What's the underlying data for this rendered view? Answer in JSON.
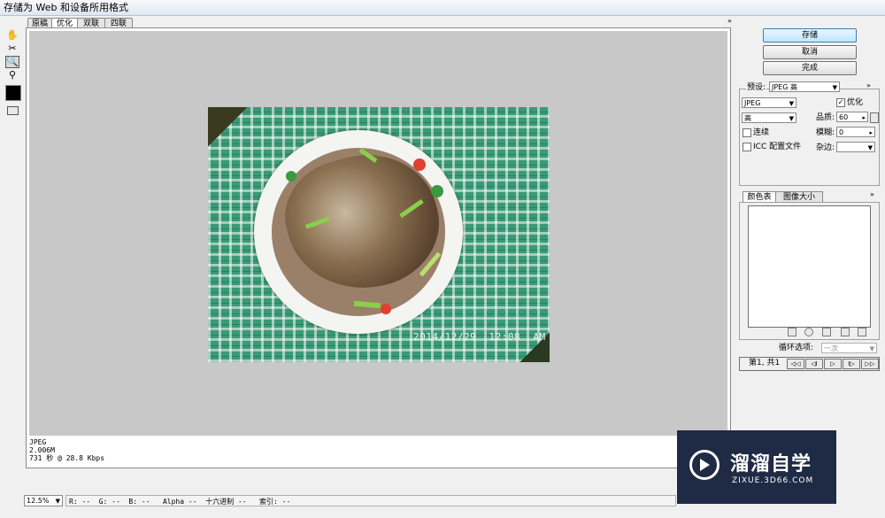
{
  "window": {
    "title": "存储为 Web 和设备所用格式"
  },
  "tabs": [
    {
      "label": "原稿"
    },
    {
      "label": "优化"
    },
    {
      "label": "双联"
    },
    {
      "label": "四联"
    }
  ],
  "tools": {
    "hand": "hand-icon",
    "slice_select": "slice-select-icon",
    "zoom": "zoom-icon",
    "eyedropper": "eyedropper-icon",
    "color_swatch": "#000000",
    "toggle_slices": "toggle-slices-icon"
  },
  "preview": {
    "photo_timestamp": "2014/12/29  12:08  AM",
    "info_format": "JPEG",
    "info_size": "2.006M",
    "info_time": "731 秒 @ 28.8 Kbps"
  },
  "buttons": {
    "save": "存储",
    "cancel": "取消",
    "done": "完成"
  },
  "settings": {
    "preset_label": "预设:",
    "preset_value": "JPEG 高",
    "format_value": "JPEG",
    "optimize_label": "优化",
    "optimize_checked": "✓",
    "quality_level": "高",
    "quality_label": "品质:",
    "quality_value": "60",
    "progressive_label": "连续",
    "blur_label": "模糊:",
    "blur_value": "0",
    "icc_label": "ICC 配置文件",
    "matte_label": "杂边:"
  },
  "color_panel": {
    "tab_color_table": "颜色表",
    "tab_image_size": "图像大小",
    "loop_label": "循环选项:",
    "loop_value": "一次",
    "frame_counter": "第1, 共1",
    "nav_first": "◁◁",
    "nav_prev": "◁I",
    "nav_play": "▷",
    "nav_next": "I▷",
    "nav_last": "▷▷"
  },
  "statusbar": {
    "zoom_value": "12.5%",
    "color_readout": "R: --  G: --  B: --   Alpha --  十六进制 --   索引: --"
  },
  "watermark": {
    "brand": "溜溜自学",
    "url": "ZIXUE.3D66.COM"
  },
  "colors": {
    "accent": "#3c7fb1",
    "watermark_bg": "#1f2a44"
  }
}
